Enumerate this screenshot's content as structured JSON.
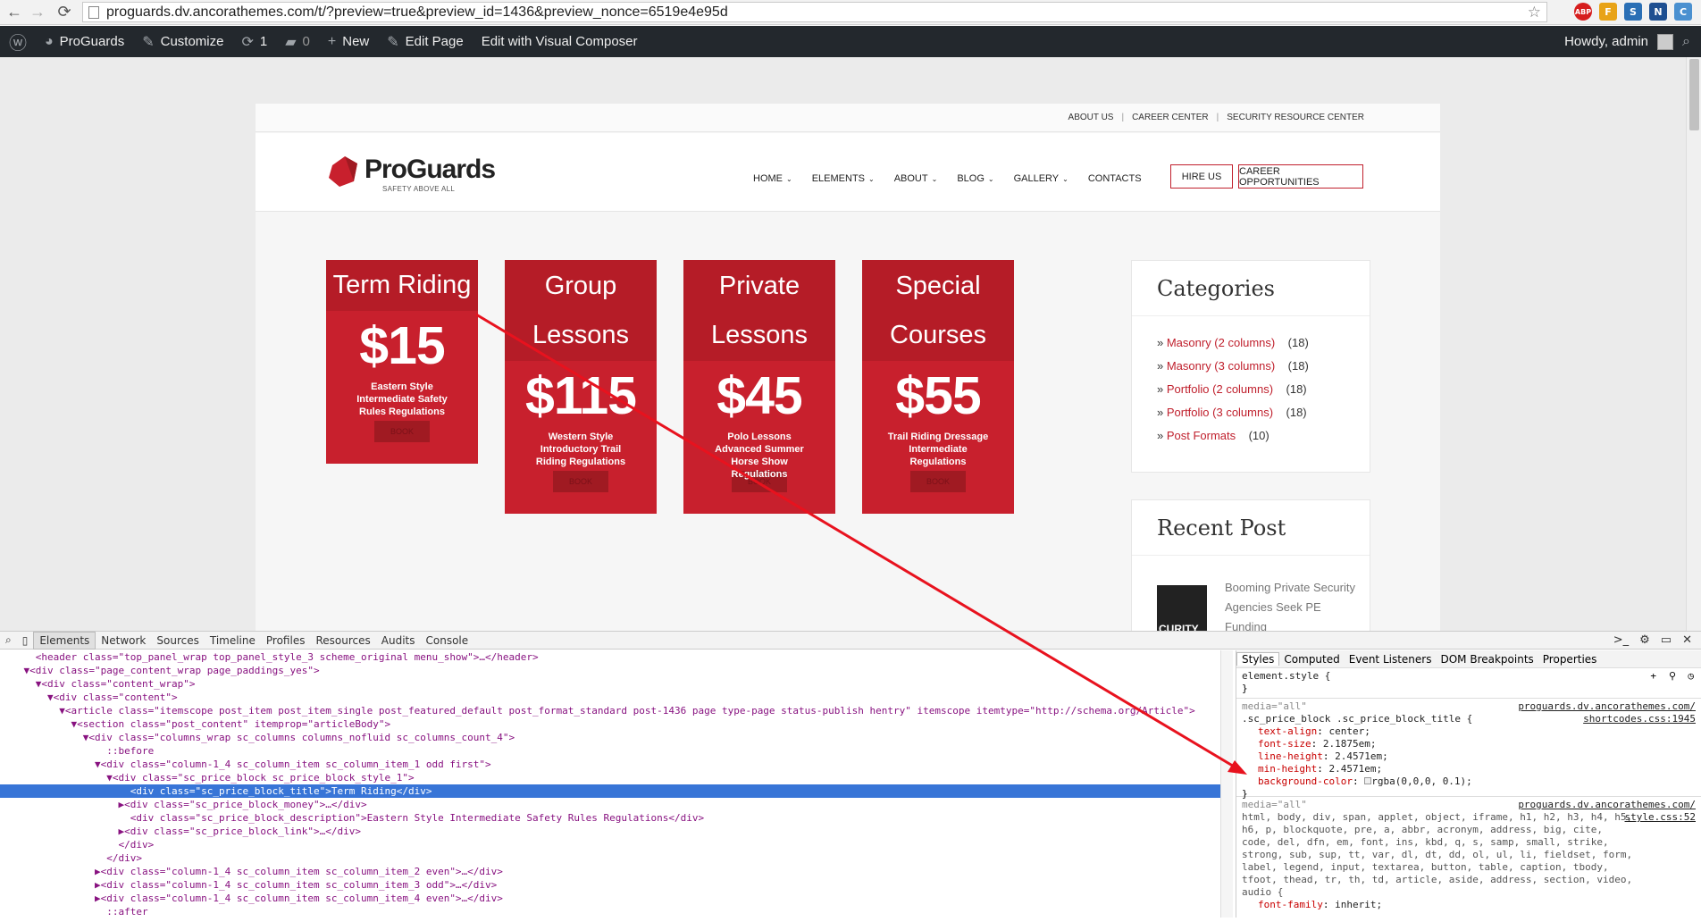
{
  "browser": {
    "url": "proguards.dv.ancorathemes.com/t/?preview=true&preview_id=1436&preview_nonce=6519e4e95d",
    "extensions": [
      "ABP",
      "F",
      "S",
      "N",
      "C"
    ]
  },
  "wp_admin_bar": {
    "site_name": "ProGuards",
    "customize": "Customize",
    "updates_count": "1",
    "comments_count": "0",
    "new": "New",
    "edit_page": "Edit Page",
    "visual_composer": "Edit with Visual Composer",
    "howdy": "Howdy, admin"
  },
  "site": {
    "top_links": [
      "ABOUT US",
      "CAREER CENTER",
      "SECURITY RESOURCE CENTER"
    ],
    "logo_text": "ProGuards",
    "tagline": "SAFETY ABOVE ALL",
    "menu": [
      {
        "label": "HOME",
        "caret": "⌄"
      },
      {
        "label": "ELEMENTS",
        "caret": "⌄"
      },
      {
        "label": "ABOUT",
        "caret": "⌄"
      },
      {
        "label": "BLOG",
        "caret": "⌄"
      },
      {
        "label": "GALLERY",
        "caret": "⌄"
      },
      {
        "label": "CONTACTS",
        "caret": ""
      }
    ],
    "hire_us": "HIRE US",
    "career_opportunities": "CAREER OPPORTUNITIES",
    "price_blocks": [
      {
        "title1": "Term Riding",
        "title2": "",
        "money": "$15",
        "desc": "Eastern Style Intermediate Safety Rules Regulations",
        "link": "BOOK"
      },
      {
        "title1": "Group",
        "title2": "Lessons",
        "money": "$115",
        "desc": "Western Style Introductory Trail Riding Regulations",
        "link": "BOOK"
      },
      {
        "title1": "Private",
        "title2": "Lessons",
        "money": "$45",
        "desc": "Polo Lessons Advanced Summer Horse Show Regulations",
        "link": "BOOK"
      },
      {
        "title1": "Special",
        "title2": "Courses",
        "money": "$55",
        "desc": "Trail Riding Dressage Intermediate Regulations",
        "link": "BOOK"
      }
    ],
    "categories_title": "Categories",
    "categories": [
      {
        "name": "Masonry (2 columns)",
        "count": "(18)"
      },
      {
        "name": "Masonry (3 columns)",
        "count": "(18)"
      },
      {
        "name": "Portfolio (2 columns)",
        "count": "(18)"
      },
      {
        "name": "Portfolio (3 columns)",
        "count": "(18)"
      },
      {
        "name": "Post Formats",
        "count": "(10)"
      }
    ],
    "recent_title": "Recent Post",
    "recent_post": "Booming Private Security Agencies Seek PE Funding",
    "recent_thumb_text": "CURITY"
  },
  "devtools": {
    "tabs": [
      "Elements",
      "Network",
      "Sources",
      "Timeline",
      "Profiles",
      "Resources",
      "Audits",
      "Console"
    ],
    "style_tabs": [
      "Styles",
      "Computed",
      "Event Listeners",
      "DOM Breakpoints",
      "Properties"
    ],
    "dom_lines": [
      "      <header class=\"top_panel_wrap top_panel_style_3 scheme_original menu_show\">…</header>",
      "    ▼<div class=\"page_content_wrap page_paddings_yes\">",
      "      ▼<div class=\"content_wrap\">",
      "        ▼<div class=\"content\">",
      "          ▼<article class=\"itemscope post_item post_item_single post_featured_default post_format_standard post-1436 page type-page status-publish hentry\" itemscope itemtype=\"http://schema.org/Article\">",
      "            ▼<section class=\"post_content\" itemprop=\"articleBody\">",
      "              ▼<div class=\"columns_wrap sc_columns columns_nofluid sc_columns_count_4\">",
      "                  ::before",
      "                ▼<div class=\"column-1_4 sc_column_item sc_column_item_1 odd first\">",
      "                  ▼<div class=\"sc_price_block sc_price_block_style_1\">",
      "                      <div class=\"sc_price_block_title\">Term Riding</div>",
      "                    ▶<div class=\"sc_price_block_money\">…</div>",
      "                      <div class=\"sc_price_block_description\">Eastern Style Intermediate Safety Rules Regulations</div>",
      "                    ▶<div class=\"sc_price_block_link\">…</div>",
      "                    </div>",
      "                  </div>",
      "                ▶<div class=\"column-1_4 sc_column_item sc_column_item_2 even\">…</div>",
      "                ▶<div class=\"column-1_4 sc_column_item sc_column_item_3 odd\">…</div>",
      "                ▶<div class=\"column-1_4 sc_column_item sc_column_item_4 even\">…</div>",
      "                  ::after"
    ],
    "selected_line_index": 10,
    "element_style": "element.style {",
    "rule1": {
      "media": "media=\"all\"",
      "source1": "proguards.dv.ancorathemes.com/",
      "source2": "shortcodes.css:1945",
      "selector": ".sc_price_block .sc_price_block_title {",
      "props": [
        {
          "name": "text-align",
          "value": "center;"
        },
        {
          "name": "font-size",
          "value": "2.1875em;"
        },
        {
          "name": "line-height",
          "value": "2.4571em;"
        },
        {
          "name": "min-height",
          "value": "2.4571em;"
        },
        {
          "name": "background-color",
          "value": "rgba(0,0,0, 0.1);"
        }
      ]
    },
    "rule2": {
      "media": "media=\"all\"",
      "source1": "proguards.dv.ancorathemes.com/",
      "source2": "style.css:52",
      "selector": "html, body, div, span, applet, object, iframe, h1, h2, h3, h4, h5, h6, p, blockquote, pre, a, abbr, acronym, address, big, cite, code, del, dfn, em, font, ins, kbd, q, s, samp, small, strike, strong, sub, sup, tt, var, dl, dt, dd, ol, ul, li, fieldset, form, label, legend, input, textarea, button, table, caption, tbody, tfoot, thead, tr, th, td, article, aside, address, section, video, audio {",
      "props": [
        {
          "name": "font-family",
          "value": "inherit;"
        }
      ]
    }
  },
  "colors": {
    "brand_red": "#c8202d",
    "annotation_arrow": "#e8121e"
  }
}
